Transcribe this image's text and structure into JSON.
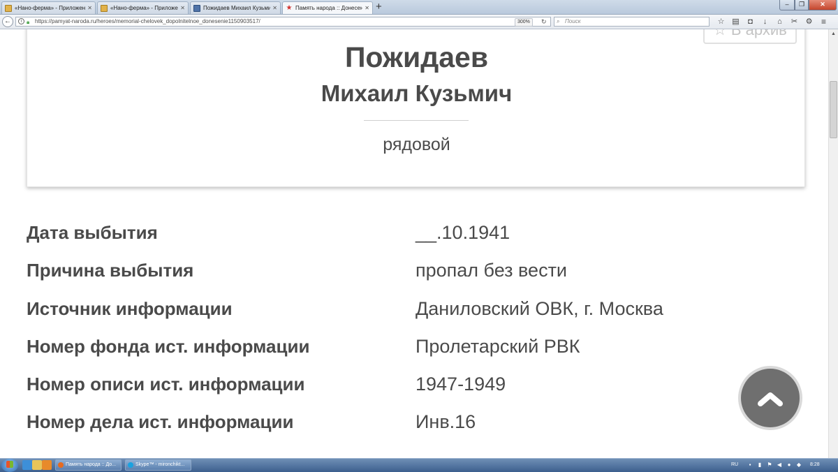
{
  "browser": {
    "tabs": [
      {
        "title": "«Нано-ферма» - Приложение",
        "active": false,
        "icon": "yellow-favicon"
      },
      {
        "title": "«Нано-ферма» - Приложение",
        "active": false,
        "icon": "yellow-favicon"
      },
      {
        "title": "Пожидаев Михаил Кузьмич",
        "active": false,
        "icon": "blue-favicon"
      },
      {
        "title": "Память народа :: Донесение",
        "active": true,
        "icon": "red-star-favicon"
      }
    ],
    "url": "https://pamyat-naroda.ru/heroes/memorial-chelovek_dopolnitelnoe_donesenie1150903517/",
    "zoom": "300%",
    "search_placeholder": "Поиск"
  },
  "card": {
    "archive_label": "В архив",
    "surname": "Пожидаев",
    "given_name": "Михаил Кузьмич",
    "rank": "рядовой"
  },
  "details": [
    {
      "label": "Дата выбытия",
      "value": "__.10.1941"
    },
    {
      "label": "Причина выбытия",
      "value": "пропал без вести"
    },
    {
      "label": "Источник информации",
      "value": "Даниловский ОВК, г. Москва"
    },
    {
      "label": "Номер фонда ист. информации",
      "value": "Пролетарский РВК"
    },
    {
      "label": "Номер описи ист. информации",
      "value": "1947-1949"
    },
    {
      "label": "Номер дела ист. информации",
      "value": "Инв.16"
    }
  ],
  "taskbar": {
    "tasks": [
      {
        "label": "Память народа :: До..."
      },
      {
        "label": "Skype™ - mironchikt..."
      }
    ],
    "language": "RU",
    "time": "8:28"
  },
  "colors": {
    "text": "#4a4a4a",
    "scroll_button": "#6f6f6f",
    "archive_button": "#c4c4c4"
  }
}
